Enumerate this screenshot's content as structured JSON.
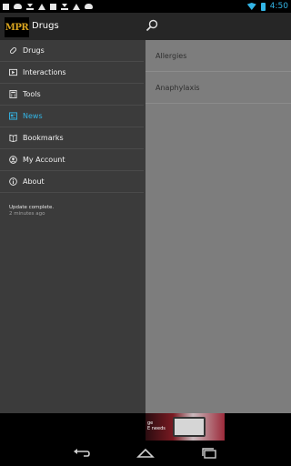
{
  "app": {
    "logo_text": "MPR",
    "title": "Drugs"
  },
  "status_bar": {
    "time": "4:50"
  },
  "drawer": {
    "items": [
      {
        "label": "Drugs",
        "icon": "pill-icon",
        "active": false
      },
      {
        "label": "Interactions",
        "icon": "interactions-icon",
        "active": false
      },
      {
        "label": "Tools",
        "icon": "calculator-icon",
        "active": false
      },
      {
        "label": "News",
        "icon": "news-icon",
        "active": true
      },
      {
        "label": "Bookmarks",
        "icon": "bookmark-icon",
        "active": false
      },
      {
        "label": "My Account",
        "icon": "account-icon",
        "active": false
      },
      {
        "label": "About",
        "icon": "info-icon",
        "active": false
      }
    ],
    "status_message": "Update complete.",
    "status_time": "2 minutes ago"
  },
  "content": {
    "items": [
      "Allergies",
      "Anaphylaxis"
    ]
  },
  "ad": {
    "text_line1": "ge",
    "text_line2": "E needs"
  },
  "colors": {
    "accent": "#33b5e5",
    "drawer_bg": "#3b3b3b",
    "content_bg": "#7d7d7d",
    "logo_gold": "#d9a520"
  }
}
